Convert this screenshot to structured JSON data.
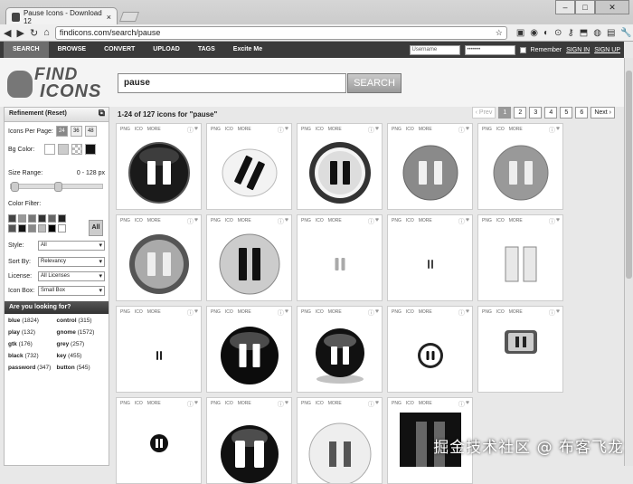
{
  "browser": {
    "tab_title": "Pause Icons - Download 12",
    "url": "findicons.com/search/pause"
  },
  "nav": {
    "items": [
      "SEARCH",
      "BROWSE",
      "CONVERT",
      "UPLOAD",
      "TAGS",
      "Excite Me"
    ],
    "username_placeholder": "Username",
    "password_placeholder": "•••••••",
    "remember": "Remember",
    "sign_in": "SIGN IN",
    "sign_up": "SIGN UP"
  },
  "logo": {
    "line1": "FIND",
    "line2": "ICONS"
  },
  "search": {
    "value": "pause",
    "button": "SEARCH"
  },
  "sidebar": {
    "title": "Refinement (Reset)",
    "per_page_label": "Icons Per Page:",
    "per_page": [
      "24",
      "36",
      "48"
    ],
    "bg_label": "Bg Color:",
    "size_label": "Size Range:",
    "size_value": "0 - 128 px",
    "color_label": "Color Filter:",
    "all": "All",
    "style_label": "Style:",
    "style_value": "All",
    "sort_label": "Sort By:",
    "sort_value": "Relevancy",
    "license_label": "License:",
    "license_value": "All Licenses",
    "iconbox_label": "Icon Box:",
    "iconbox_value": "Small Box",
    "looking": "Are you looking for?",
    "tags": [
      {
        "name": "blue",
        "count": "(1824)"
      },
      {
        "name": "control",
        "count": "(315)"
      },
      {
        "name": "play",
        "count": "(132)"
      },
      {
        "name": "gnome",
        "count": "(1572)"
      },
      {
        "name": "gtk",
        "count": "(176)"
      },
      {
        "name": "grey",
        "count": "(257)"
      },
      {
        "name": "black",
        "count": "(732)"
      },
      {
        "name": "key",
        "count": "(455)"
      },
      {
        "name": "password",
        "count": "(347)"
      },
      {
        "name": "button",
        "count": "(545)"
      }
    ]
  },
  "results": {
    "summary": "1-24 of 127 icons for \"pause\"",
    "prev": "‹ Prev",
    "pages": [
      "1",
      "2",
      "3",
      "4",
      "5",
      "6"
    ],
    "next": "Next ›",
    "format_labels": [
      "PNG",
      "ICO",
      "MORE"
    ]
  },
  "watermark": "掘金技术社区 @ 布客飞龙"
}
